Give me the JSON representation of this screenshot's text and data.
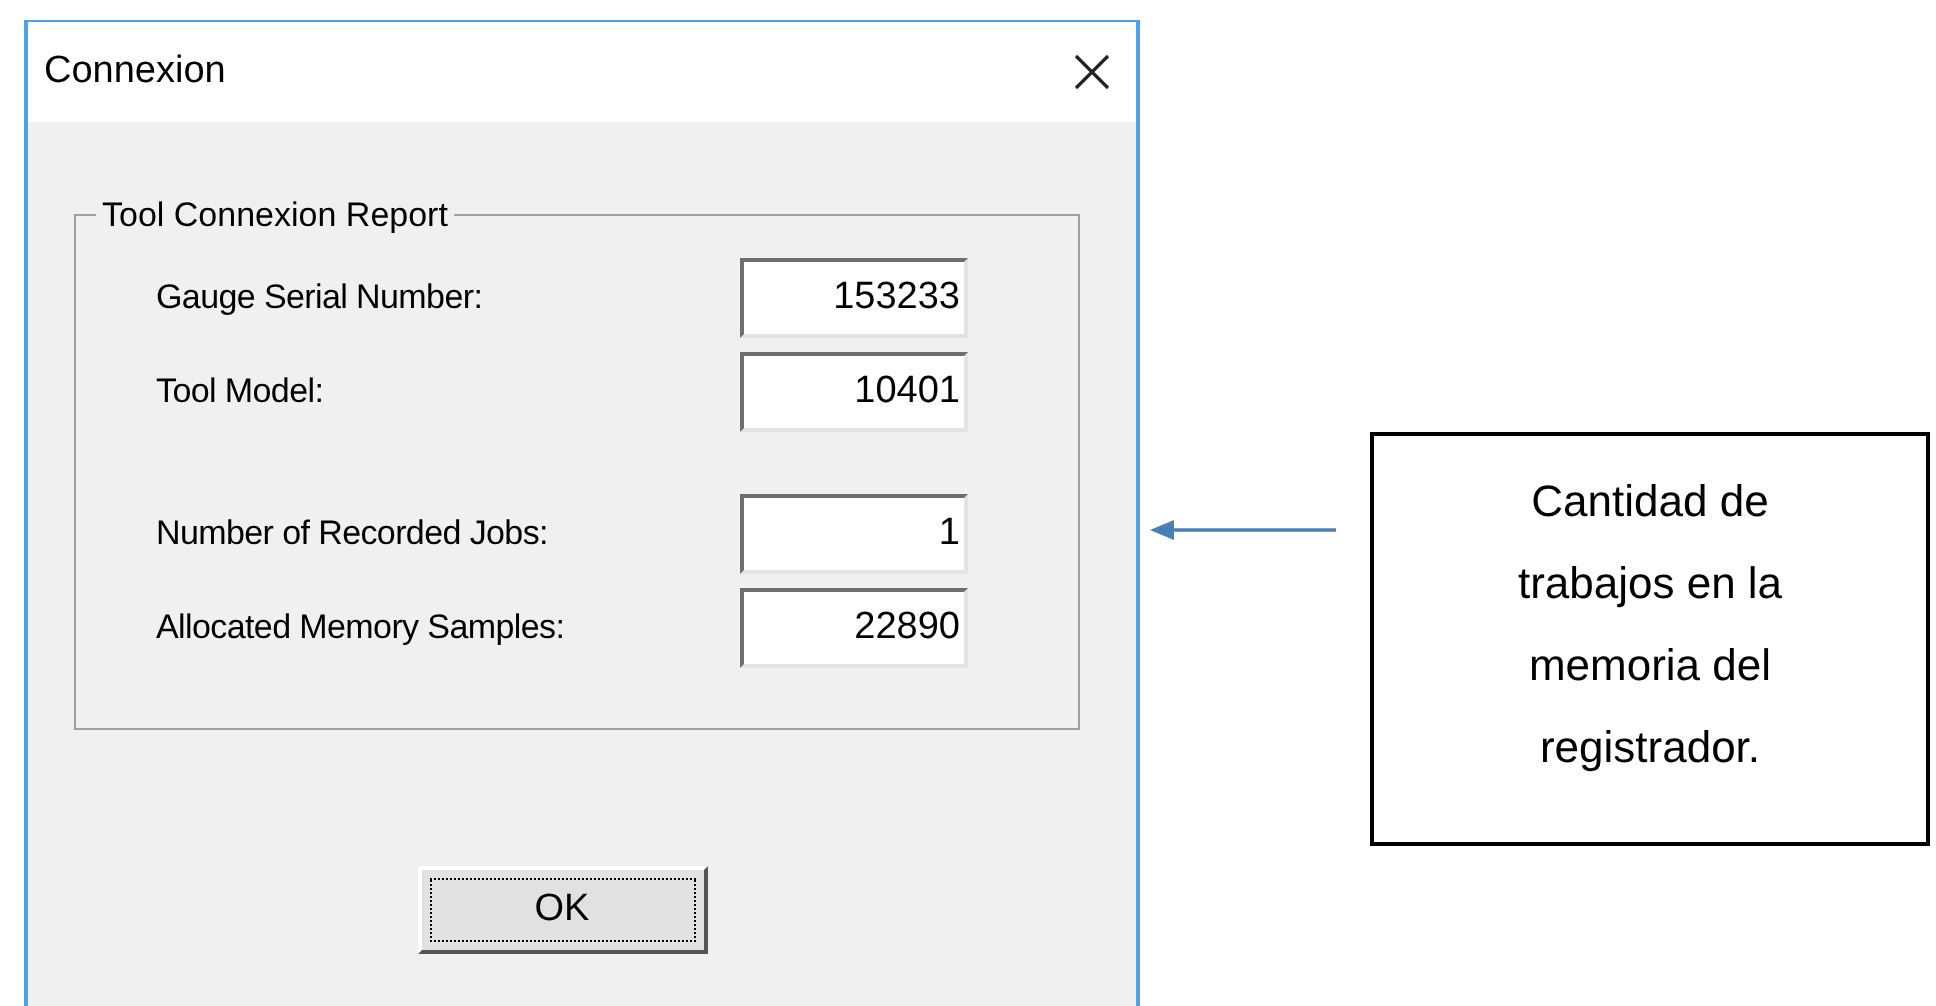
{
  "window": {
    "title": "Connexion"
  },
  "group": {
    "title": "Tool Connexion Report",
    "fields": [
      {
        "label": "Gauge Serial Number:",
        "value": "153233"
      },
      {
        "label": "Tool Model:",
        "value": "10401"
      },
      {
        "label": "Number of Recorded Jobs:",
        "value": "1"
      },
      {
        "label": "Allocated Memory Samples:",
        "value": "22890"
      }
    ]
  },
  "buttons": [
    {
      "label": "OK",
      "focused": true
    }
  ],
  "annotation": {
    "text": "Cantidad de trabajos en la memoria del registrador."
  }
}
